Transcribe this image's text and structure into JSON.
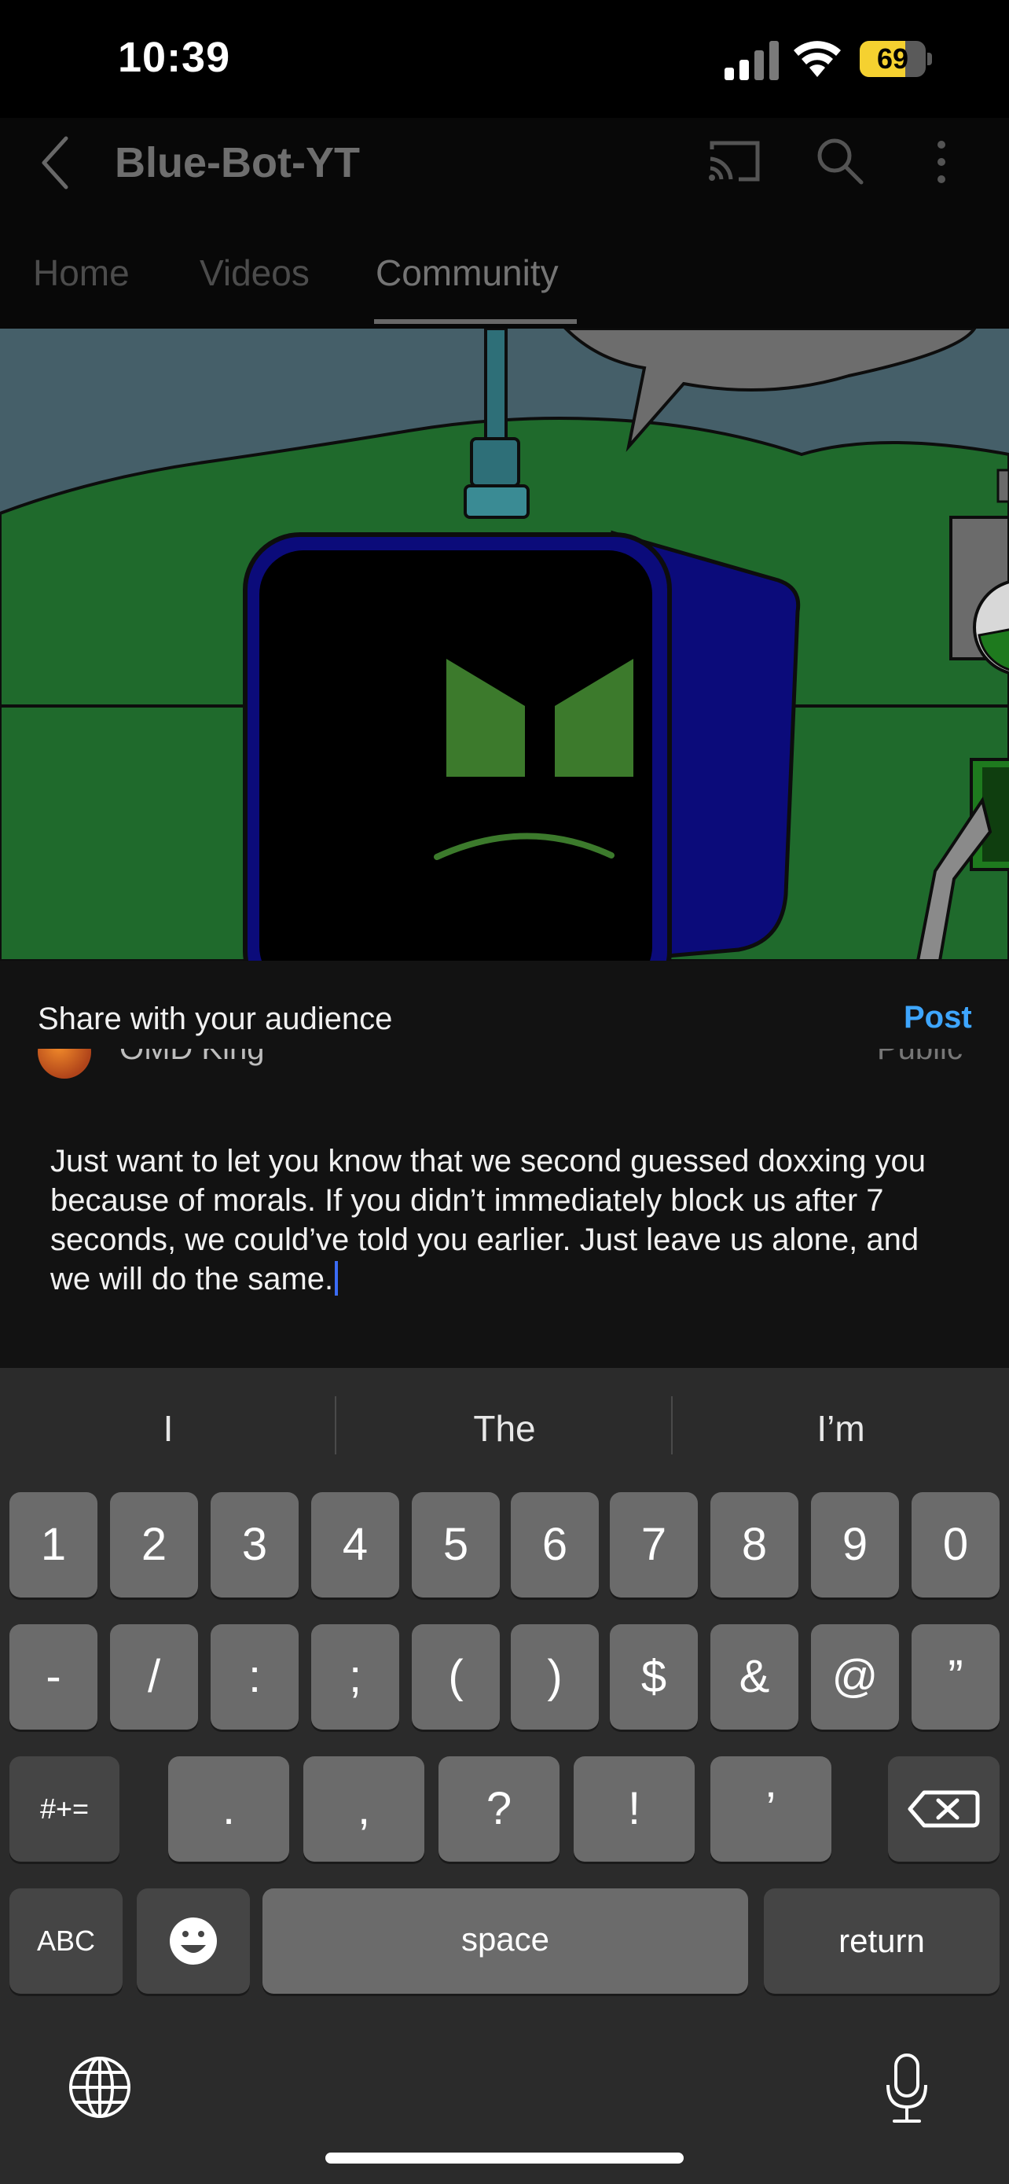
{
  "status_bar": {
    "time": "10:39",
    "battery": "69",
    "battery_level": 0.69
  },
  "header": {
    "channel_title": "Blue-Bot-YT",
    "tabs": [
      {
        "label": "Home",
        "active": false
      },
      {
        "label": "Videos",
        "active": false
      },
      {
        "label": "Community",
        "active": true
      }
    ]
  },
  "compose": {
    "share_label": "Share with your audience",
    "post_label": "Post",
    "author_name": "OMD King",
    "visibility": "Public",
    "text": "Just want to let you know that we second guessed doxxing you because of morals. If you didn’t immediately block us after 7 seconds, we could’ve told you earlier. Just leave us alone, and we will do the same."
  },
  "keyboard": {
    "suggestions": [
      "I",
      "The",
      "I’m"
    ],
    "row1": [
      "1",
      "2",
      "3",
      "4",
      "5",
      "6",
      "7",
      "8",
      "9",
      "0"
    ],
    "row2": [
      "-",
      "/",
      ":",
      ";",
      "(",
      ")",
      "$",
      "&",
      "@",
      "”"
    ],
    "row3": {
      "mode": "#+=",
      "keys": [
        ".",
        ",",
        "?",
        "!",
        "’"
      ]
    },
    "row4": {
      "abc": "ABC",
      "space": "space",
      "return": "return"
    }
  },
  "colors": {
    "accent": "#3ea6ff",
    "battery": "#f5d130",
    "caret": "#3b6cf5"
  }
}
